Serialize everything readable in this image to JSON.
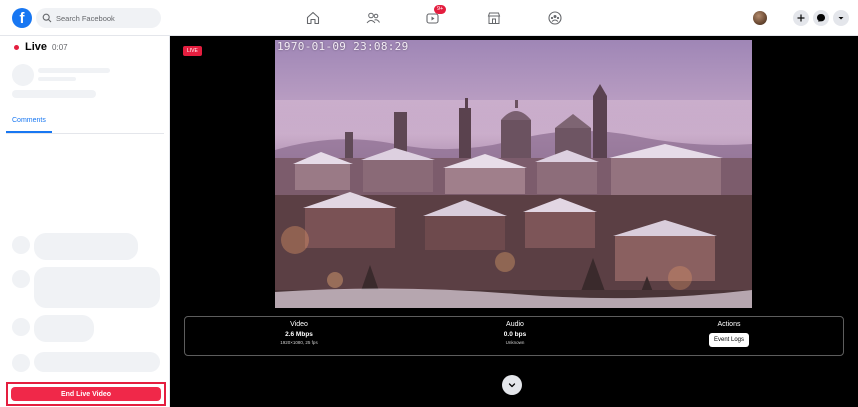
{
  "topbar": {
    "search_placeholder": "Search Facebook",
    "watch_badge": "9+",
    "logo_letter": "f"
  },
  "sidebar": {
    "live_label": "Live",
    "live_time": "0:07",
    "comments_tab": "Comments",
    "end_button": "End Live Video"
  },
  "stage": {
    "live_tag": "LIVE",
    "timestamp": "1970-01-09 23:08:29"
  },
  "stats": {
    "video_title": "Video",
    "video_value": "2.6 Mbps",
    "video_sub": "1920×1080, 25 fps",
    "audio_title": "Audio",
    "audio_value": "0.0 bps",
    "audio_sub": "Unknown",
    "actions_title": "Actions",
    "event_logs": "Event Logs"
  },
  "colors": {
    "brand": "#1877f2",
    "live_red": "#e41e3f",
    "end_button": "#f02849"
  },
  "icons": [
    "facebook-logo-icon",
    "search-icon",
    "home-icon",
    "friends-icon",
    "watch-icon",
    "marketplace-icon",
    "groups-icon",
    "plus-icon",
    "messenger-icon",
    "chevron-down-icon"
  ]
}
